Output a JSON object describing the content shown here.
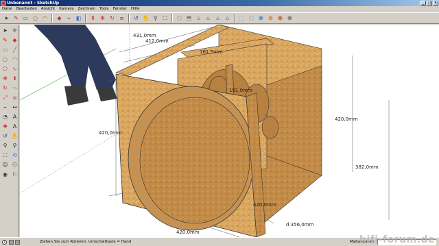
{
  "window": {
    "title": "Unbenannt - SketchUp"
  },
  "menu": [
    "Datei",
    "Bearbeiten",
    "Ansicht",
    "Kamera",
    "Zeichnen",
    "Tools",
    "Fenster",
    "Hilfe"
  ],
  "toolbar_icons": [
    "select-icon",
    "pencil-icon",
    "rectangle-icon",
    "circle-icon",
    "arc-icon",
    "eraser-icon",
    "tape-icon",
    "paint-icon",
    "pushpull-icon",
    "move-icon",
    "rotate-icon",
    "offset-icon",
    "orbit-icon",
    "pan-icon",
    "zoom-icon",
    "zoom-extents-icon",
    "iso-view-icon",
    "top-view-icon",
    "front-view-icon",
    "right-view-icon",
    "back-view-icon",
    "left-view-icon",
    "xray-icon",
    "wireframe-icon",
    "hidden-line-icon",
    "shaded-icon",
    "textured-icon",
    "monochrome-icon"
  ],
  "left_tools": [
    "select-icon",
    "component-icon",
    "pencil-icon",
    "eraser-icon",
    "rectangle-icon",
    "line-icon",
    "circle-icon",
    "arc-icon",
    "polygon-icon",
    "freehand-icon",
    "move-icon",
    "pushpull-icon",
    "rotate-icon",
    "followme-icon",
    "scale-icon",
    "offset-icon",
    "tape-icon",
    "dimension-icon",
    "protractor-icon",
    "text-icon",
    "axes-icon",
    "3dtext-icon",
    "orbit-icon",
    "pan-icon",
    "zoom-icon",
    "zoom-window-icon",
    "zoom-extents-icon",
    "previous-icon",
    "position-camera-icon",
    "walk-icon",
    "lookaround-icon",
    "section-icon"
  ],
  "dimensions": {
    "top_left_1": "431,0mm",
    "top_left_2": "412,0mm",
    "top_inner": "161,5mm",
    "inner_mid": "191,0mm",
    "left_height": "420,0mm",
    "right_height": "420,0mm",
    "right_outer": "382,0mm",
    "bottom_mid": "420,0mm",
    "bottom_diam": "d 356,0mm",
    "bottom_width": "420,0mm"
  },
  "status": {
    "help_icon": "?",
    "message": "Ziehen Sie zum Rotieren.  Umschalttaste = Hand",
    "measurements_label": "Maßangaben",
    "measurements_value": ""
  },
  "watermark": "hifi-forum.de",
  "colors": {
    "title_start": "#0a246a",
    "wood": "#d9a55f",
    "wood_dark": "#b9823f",
    "background": "#ffffff"
  }
}
